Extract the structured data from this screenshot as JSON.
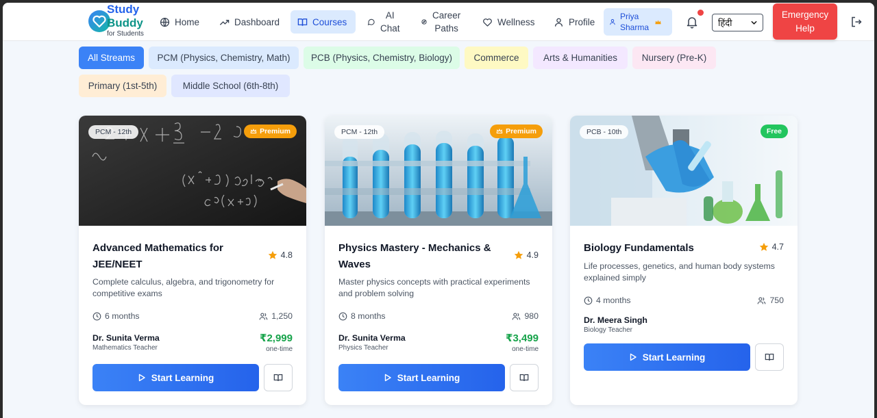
{
  "brand": {
    "line1": "Study",
    "line2": "Buddy",
    "tagline": "for Students"
  },
  "nav": {
    "home": "Home",
    "dashboard": "Dashboard",
    "courses": "Courses",
    "ai_chat_1": "AI",
    "ai_chat_2": "Chat",
    "career_1": "Career",
    "career_2": "Paths",
    "wellness": "Wellness",
    "profile": "Profile"
  },
  "user": {
    "first": "Priya",
    "last": "Sharma"
  },
  "language": {
    "selected": "हिंदी"
  },
  "emergency": {
    "line1": "Emergency",
    "line2": "Help"
  },
  "filters": [
    {
      "label": "All Streams",
      "bg": "#3b82f6",
      "color": "#ffffff"
    },
    {
      "label": "PCM (Physics, Chemistry, Math)",
      "bg": "#dbeafe"
    },
    {
      "label": "PCB (Physics, Chemistry, Biology)",
      "bg": "#dcfce7"
    },
    {
      "label": "Commerce",
      "bg": "#fef9c3"
    },
    {
      "label": "Arts & Humanities",
      "bg": "#f3e8ff"
    },
    {
      "label": "Nursery (Pre-K)",
      "bg": "#fce7f3"
    },
    {
      "label": "Primary (1st-5th)",
      "bg": "#ffedd5"
    },
    {
      "label": "Middle School (6th-8th)",
      "bg": "#e0e7ff"
    }
  ],
  "courses": [
    {
      "tag": "PCM - 12th",
      "badge": "Premium",
      "title": "Advanced Mathematics for JEE/NEET",
      "rating": "4.8",
      "description": "Complete calculus, algebra, and trigonometry for competitive exams",
      "duration": "6 months",
      "students": "1,250",
      "teacher": "Dr. Sunita Verma",
      "teacher_role": "Mathematics Teacher",
      "price": "₹2,999",
      "price_note": "one-time",
      "cta": "Start Learning"
    },
    {
      "tag": "PCM - 12th",
      "badge": "Premium",
      "title": "Physics Mastery - Mechanics & Waves",
      "rating": "4.9",
      "description": "Master physics concepts with practical experiments and problem solving",
      "duration": "8 months",
      "students": "980",
      "teacher": "Dr. Sunita Verma",
      "teacher_role": "Physics Teacher",
      "price": "₹3,499",
      "price_note": "one-time",
      "cta": "Start Learning"
    },
    {
      "tag": "PCB - 10th",
      "badge": "Free",
      "title": "Biology Fundamentals",
      "rating": "4.7",
      "description": "Life processes, genetics, and human body systems explained simply",
      "duration": "4 months",
      "students": "750",
      "teacher": "Dr. Meera Singh",
      "teacher_role": "Biology Teacher",
      "cta": "Start Learning"
    }
  ],
  "colors": {
    "accent": "#3b82f6",
    "emergency": "#ef4444",
    "premium": "#f59e0b",
    "free": "#22c55e",
    "price": "#16a34a"
  }
}
